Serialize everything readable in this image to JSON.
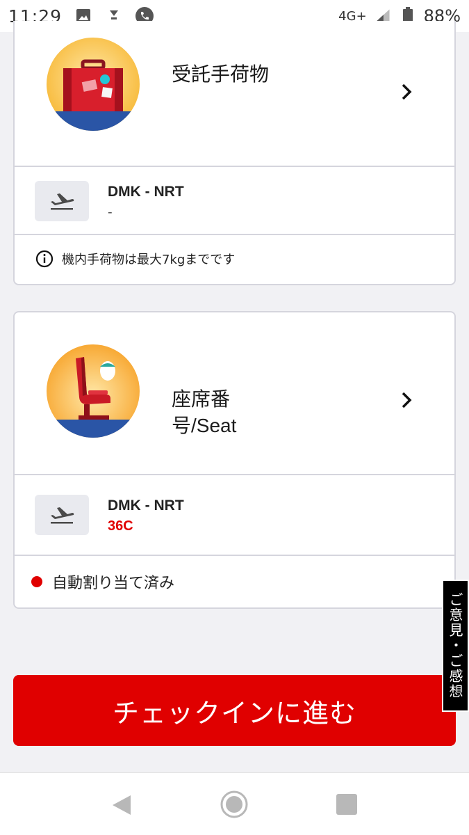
{
  "status_bar": {
    "time": "11:29",
    "network": "4G+",
    "battery": "88%"
  },
  "baggage_card": {
    "title": "受託手荷物",
    "route": "DMK - NRT",
    "value": "-",
    "note": "機内手荷物は最大7kgまでです"
  },
  "seat_card": {
    "title": "座席番号/Seat",
    "route": "DMK - NRT",
    "seat": "36C",
    "status": "自動割り当て済み"
  },
  "cta": {
    "label": "チェックインに進む"
  },
  "feedback": {
    "label": "ご意見・ご感想"
  },
  "colors": {
    "accent": "#e00000",
    "background": "#f1f1f4",
    "border": "#d5d5dd"
  }
}
